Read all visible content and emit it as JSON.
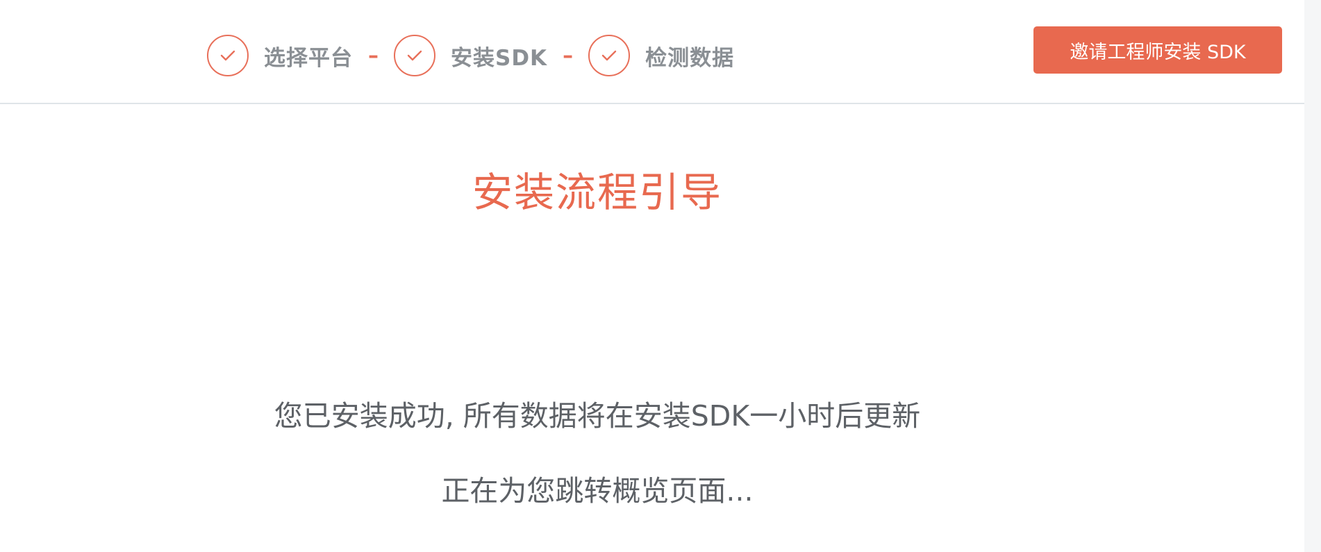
{
  "steps": [
    {
      "label": "选择平台",
      "status": "done"
    },
    {
      "label": "安装SDK",
      "status": "done"
    },
    {
      "label": "检测数据",
      "status": "done"
    }
  ],
  "step_separator": "–",
  "icons": {
    "step_done": "check-circle-icon"
  },
  "header": {
    "invite_button_label": "邀请工程师安装 SDK"
  },
  "main": {
    "title": "安装流程引导",
    "success_message": "您已安装成功, 所有数据将在安装SDK一小时后更新",
    "redirect_message": "正在为您跳转概览页面..."
  },
  "colors": {
    "accent": "#e8694f",
    "step_text": "#8a8f94",
    "body_text": "#5d6166",
    "divider": "#dfe5e8"
  }
}
